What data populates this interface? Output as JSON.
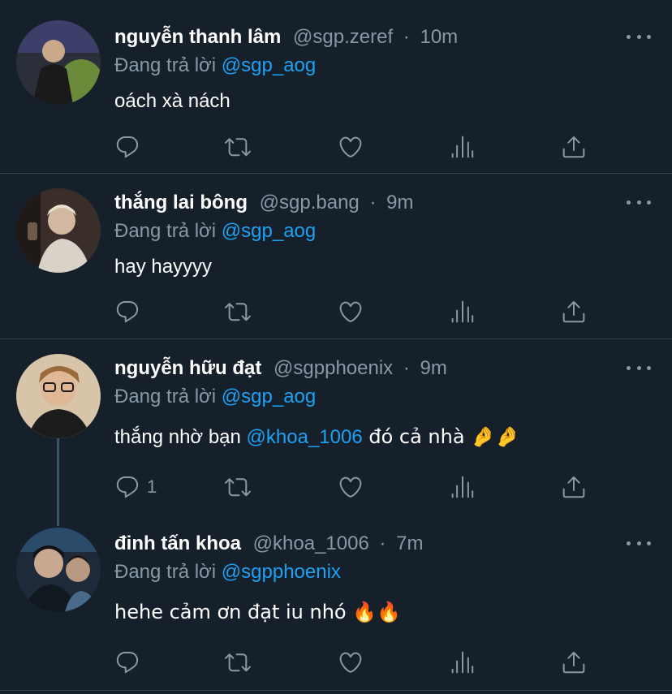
{
  "tweets": [
    {
      "name": "nguyễn thanh lâm",
      "handle": "@sgp.zeref",
      "time": "10m",
      "reply_prefix": "Đang trả lời",
      "reply_to": "@sgp_aog",
      "text_before": "oách xà nách",
      "mention": "",
      "text_after": "",
      "reply_count": "",
      "avatar_colors": [
        "#2a2f3a",
        "#6b8a3a",
        "#c9c9b0"
      ]
    },
    {
      "name": "thắng lai bông",
      "handle": "@sgp.bang",
      "time": "9m",
      "reply_prefix": "Đang trả lời",
      "reply_to": "@sgp_aog",
      "text_before": "hay hayyyy",
      "mention": "",
      "text_after": "",
      "reply_count": "",
      "avatar_colors": [
        "#3a2e2a",
        "#d8d2c8",
        "#6e5a48"
      ]
    },
    {
      "name": "nguyễn hữu đạt",
      "handle": "@sgpphoenix",
      "time": "9m",
      "reply_prefix": "Đang trả lời",
      "reply_to": "@sgp_aog",
      "text_before": "thắng nhờ bạn ",
      "mention": "@khoa_1006",
      "text_after": " đó cả nhà 🤌🤌",
      "reply_count": "1",
      "avatar_colors": [
        "#d8c4a8",
        "#1c1c1c",
        "#e0b896"
      ]
    },
    {
      "name": "đinh tấn khoa",
      "handle": "@khoa_1006",
      "time": "7m",
      "reply_prefix": "Đang trả lời",
      "reply_to": "@sgpphoenix",
      "text_before": "hehe cảm ơn đạt iu nhó 🔥🔥",
      "mention": "",
      "text_after": "",
      "reply_count": "",
      "avatar_colors": [
        "#1e2a3a",
        "#4a6a8a",
        "#c8a890"
      ]
    }
  ],
  "separator": "·",
  "icons": {
    "reply": "reply-icon",
    "retweet": "retweet-icon",
    "like": "heart-icon",
    "analytics": "analytics-icon",
    "share": "share-icon",
    "more": "more-icon"
  },
  "colors": {
    "background": "#15202b",
    "secondary_text": "#8899a6",
    "link": "#1da1f2",
    "divider": "#38444d"
  }
}
